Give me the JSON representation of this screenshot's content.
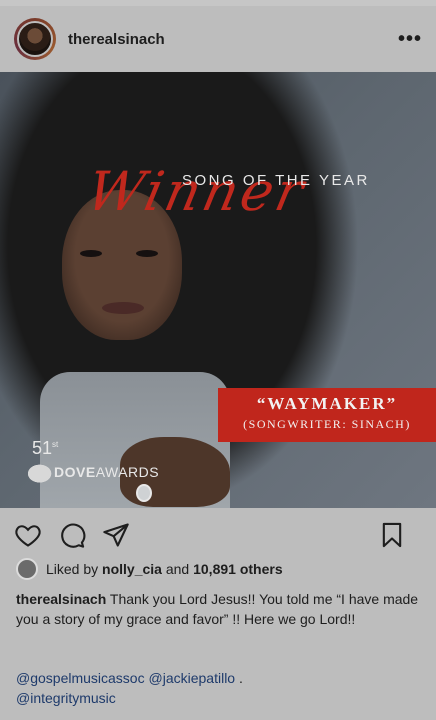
{
  "post": {
    "username": "therealsinach",
    "more_label": "•••",
    "image": {
      "song_of_the_year": "SONG OF THE YEAR",
      "winner": "Winner",
      "song_title": "“WAYMAKER”",
      "songwriter": "(SONGWRITER: SINACH)",
      "award_number": "51",
      "award_suffix": "st",
      "award_name_bold": "DOVE",
      "award_name_rest": "AWARDS"
    },
    "likes": {
      "prefix": "Liked by",
      "liker": "nolly_cia",
      "joiner": "and",
      "others": "10,891 others"
    },
    "caption": {
      "user": "therealsinach",
      "text": "Thank you Lord Jesus!! You told me “I have made you a story of my grace and favor” !! Here we go Lord!!"
    },
    "mentions": {
      "m1": "@gospelmusicassoc",
      "m2": "@jackiepatillo",
      "dot": ".",
      "m3": "@integritymusic"
    }
  },
  "colors": {
    "background": "#bdbdbd",
    "banner_red": "#c0261c",
    "mention_blue": "#1e3a6b"
  }
}
